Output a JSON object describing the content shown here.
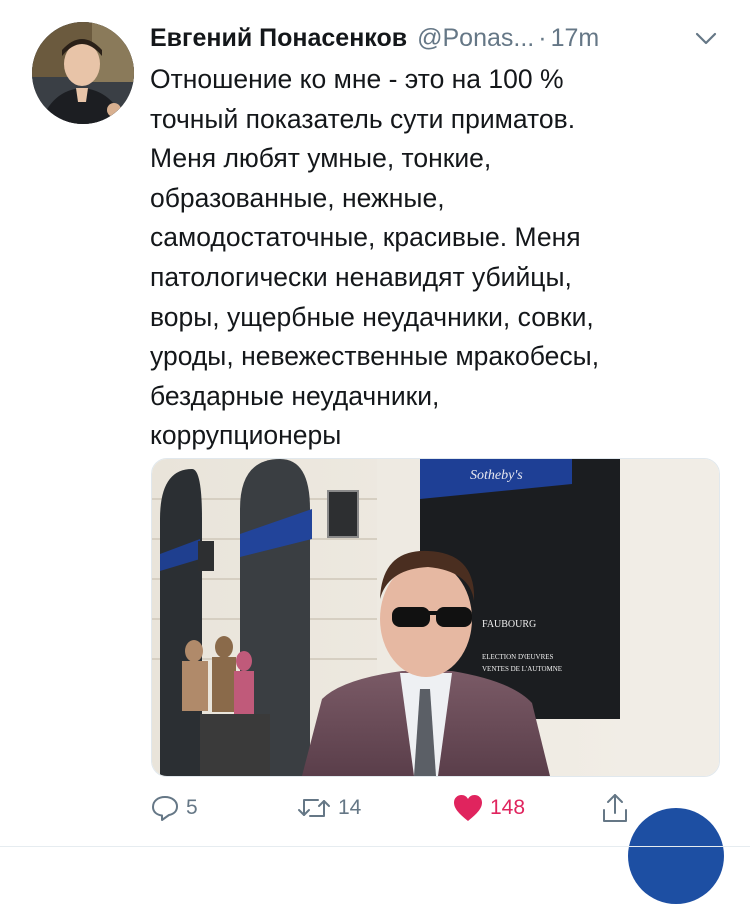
{
  "tweet": {
    "author_name": "Евгений Понасенков",
    "handle": "@Ponas...",
    "separator": "·",
    "time": "17m",
    "text_lines": [
      "Отношение ко мне - это на 100 %",
      "точный показатель сути приматов.",
      "Меня любят умные, тонкие,",
      "образованные, нежные,",
      "самодостаточные, красивые. Меня",
      "патологически ненавидят убийцы,",
      "воры, ущербные неудачники, совки,",
      "уроды, невежественные мракобесы,",
      "бездарные неудачники,",
      "коррупционеры"
    ],
    "media": {
      "awning_text": "Sotheby's",
      "window_lines": [
        "FAUBOURG",
        "ELECTION D'ŒUVRES",
        "VENTES DE L'AUTOMNE"
      ]
    }
  },
  "actions": {
    "replies": "5",
    "retweets": "14",
    "likes": "148"
  },
  "colors": {
    "text": "#14171a",
    "secondary": "#657786",
    "like": "#e0245e",
    "fab": "#1d4fa3"
  },
  "icons": [
    "chevron-down-icon",
    "reply-icon",
    "retweet-icon",
    "heart-icon",
    "share-icon"
  ]
}
